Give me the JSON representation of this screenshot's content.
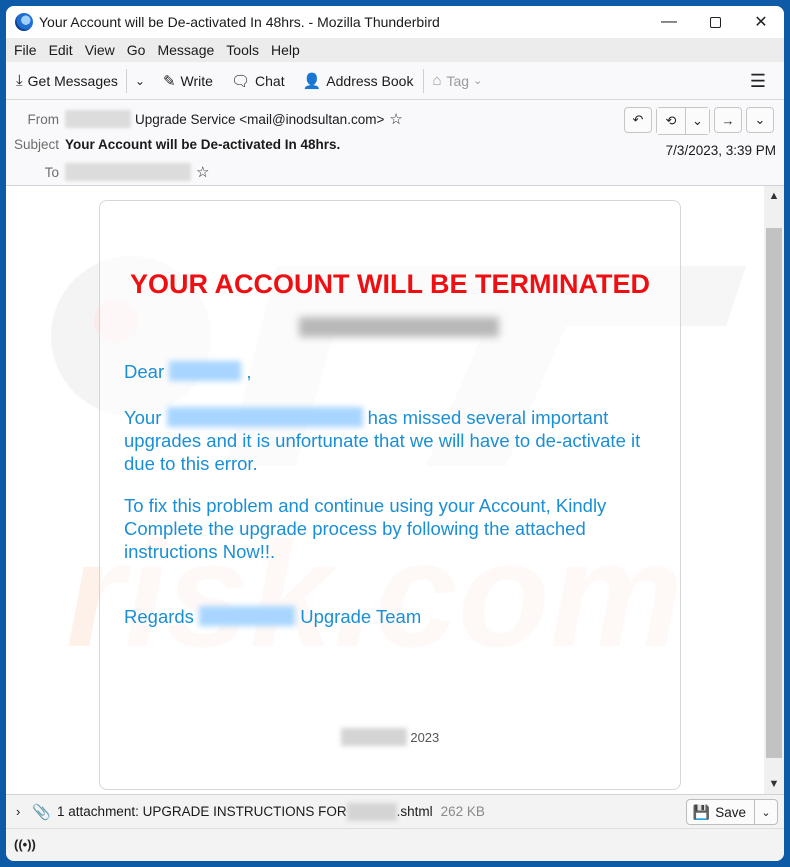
{
  "window": {
    "title": "Your Account will be De-activated In 48hrs. - Mozilla Thunderbird",
    "controls": {
      "minimize": "—",
      "close": "✕"
    }
  },
  "menu": [
    "File",
    "Edit",
    "View",
    "Go",
    "Message",
    "Tools",
    "Help"
  ],
  "toolbar": {
    "get_messages": "Get Messages",
    "write": "Write",
    "chat": "Chat",
    "address_book": "Address Book",
    "tag": "Tag",
    "icons": {
      "get_messages": "⤓",
      "write": "✎",
      "chat": "🗨",
      "address_book": "👤",
      "tag": "⌂",
      "dropdown": "⌄",
      "menu": "☰"
    }
  },
  "header": {
    "from_label": "From",
    "from_value": "Upgrade Service <mail@inodsultan.com>",
    "subject_label": "Subject",
    "subject_value": "Your Account will be De-activated In 48hrs.",
    "to_label": "To",
    "date": "7/3/2023, 3:39 PM",
    "star": "☆",
    "buttons": {
      "reply": "↶",
      "reply_all": "⟲",
      "reply_all_dd": "⌄",
      "forward": "→",
      "more": "⌄"
    }
  },
  "email": {
    "headline": "YOUR ACCOUNT WILL BE TERMINATED",
    "greeting_prefix": "Dear",
    "greeting_suffix": ",",
    "p1_prefix": "Your",
    "p1_rest": "has missed several important upgrades and it is unfortunate that we will have to de-activate it due to this error.",
    "p2": "To fix this problem and continue using your Account, Kindly Complete the upgrade process by following the attached instructions Now!!.",
    "regards_prefix": "Regards",
    "regards_suffix": "Upgrade Team",
    "footer_year": "2023",
    "colors": {
      "headline": "#ee0f13",
      "body": "#1a8fd6"
    }
  },
  "attachment": {
    "summary_prefix": "1 attachment: UPGRADE INSTRUCTIONS FOR",
    "summary_suffix": ".shtml",
    "size": "262 KB",
    "save_label": "Save",
    "expand_icon": "›",
    "clip_icon": "📎"
  },
  "status": {
    "icon": "((•))"
  },
  "scrollbar": {
    "up": "▲",
    "down": "▼"
  }
}
